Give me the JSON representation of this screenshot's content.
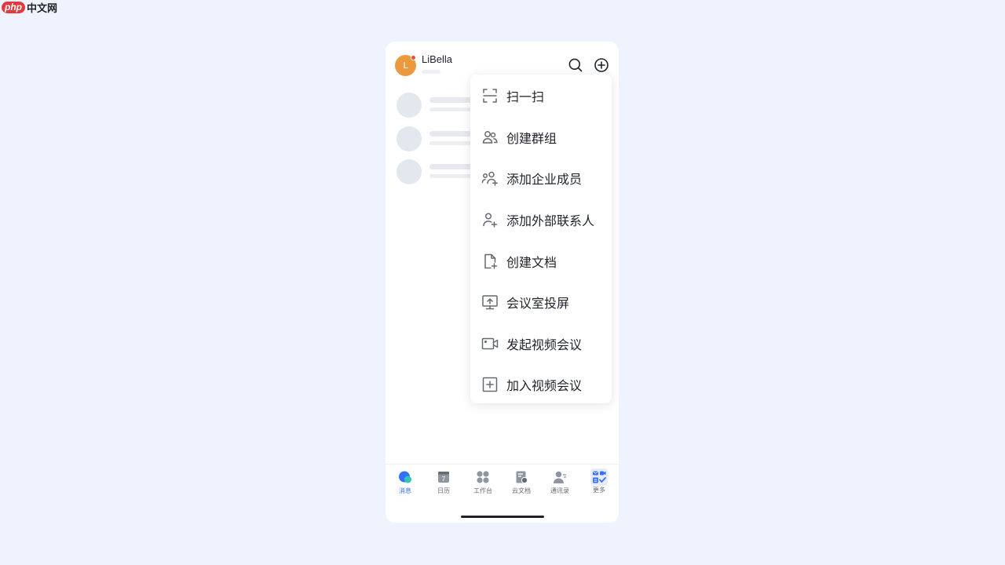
{
  "watermark": {
    "logo": "php",
    "text": "中文网"
  },
  "header": {
    "avatar_initial": "L",
    "username": "LiBella",
    "search_icon": "search-icon",
    "add_icon": "plus-circle-icon"
  },
  "menu": {
    "items": [
      {
        "label": "扫一扫",
        "icon": "scan-icon"
      },
      {
        "label": "创建群组",
        "icon": "group-icon"
      },
      {
        "label": "添加企业成员",
        "icon": "add-members-icon"
      },
      {
        "label": "添加外部联系人",
        "icon": "add-contact-icon"
      },
      {
        "label": "创建文档",
        "icon": "new-doc-icon"
      },
      {
        "label": "会议室投屏",
        "icon": "screen-share-icon"
      },
      {
        "label": "发起视频会议",
        "icon": "video-camera-icon"
      },
      {
        "label": "加入视频会议",
        "icon": "plus-square-icon"
      }
    ]
  },
  "tabbar": {
    "items": [
      {
        "label": "消息",
        "icon": "message-icon",
        "active": true
      },
      {
        "label": "日历",
        "icon": "calendar-icon",
        "badge": "7"
      },
      {
        "label": "工作台",
        "icon": "apps-grid-icon"
      },
      {
        "label": "云文档",
        "icon": "cloud-doc-icon"
      },
      {
        "label": "通讯录",
        "icon": "contacts-icon"
      },
      {
        "label": "更多",
        "icon": "more-apps-icon"
      }
    ]
  },
  "colors": {
    "background": "#eef3fd",
    "accent": "#3370ff",
    "avatar": "#ea9a3d",
    "status_dot": "#ef4b3f",
    "text": "#1f2329"
  }
}
